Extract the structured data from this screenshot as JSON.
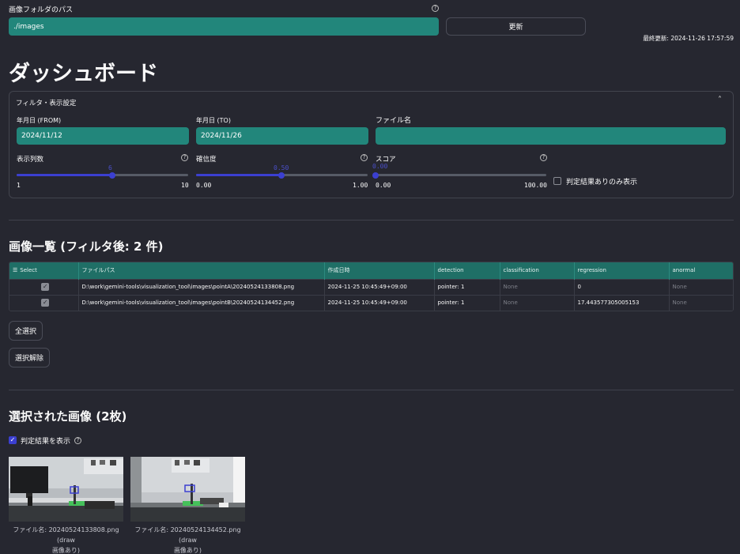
{
  "folder": {
    "label": "画像フォルダのパス",
    "value": "./images",
    "refresh_button": "更新",
    "last_updated": "最終更新: 2024-11-26 17:57:59"
  },
  "title": "ダッシュボード",
  "filter": {
    "header": "フィルタ・表示設定",
    "date_from": {
      "label": "年月日 (FROM)",
      "value": "2024/11/12"
    },
    "date_to": {
      "label": "年月日 (TO)",
      "value": "2024/11/26"
    },
    "filename": {
      "label": "ファイル名",
      "value": ""
    },
    "columns_slider": {
      "label": "表示列数",
      "value": "6",
      "fraction": 0.56,
      "min": "1",
      "max": "10"
    },
    "confidence_slider": {
      "label": "確信度",
      "value": "0.50",
      "fraction": 0.5,
      "min": "0.00",
      "max": "1.00"
    },
    "score_slider": {
      "label": "スコア",
      "value": "0.00",
      "fraction": 0.0,
      "min": "0.00",
      "max": "100.00"
    },
    "judged_only": "判定結果ありのみ表示"
  },
  "list": {
    "heading": "画像一覧 (フィルタ後: 2 件)",
    "columns": [
      "Select",
      "ファイルパス",
      "作成日時",
      "detection",
      "classification",
      "regression",
      "anormal"
    ],
    "rows": [
      {
        "path": "D:\\work\\gemini-tools\\visualization_tool\\images\\pointA\\20240524133808.png",
        "created": "2024-11-25 10:45:49+09:00",
        "detection": "pointer: 1",
        "classification": "None",
        "regression": "0",
        "anormal": "None"
      },
      {
        "path": "D:\\work\\gemini-tools\\visualization_tool\\images\\pointB\\20240524134452.png",
        "created": "2024-11-25 10:45:49+09:00",
        "detection": "pointer: 1",
        "classification": "None",
        "regression": "17.443577305005153",
        "anormal": "None"
      }
    ],
    "select_all": "全選択",
    "deselect": "選択解除"
  },
  "selected": {
    "heading": "選択された画像 (2枚)",
    "show_result": "判定結果を表示",
    "captions": [
      {
        "line1": "ファイル名: 20240524133808.png (draw",
        "line2": "画像あり)"
      },
      {
        "line1": "ファイル名: 20240524134452.png (draw",
        "line2": "画像あり)"
      }
    ]
  }
}
